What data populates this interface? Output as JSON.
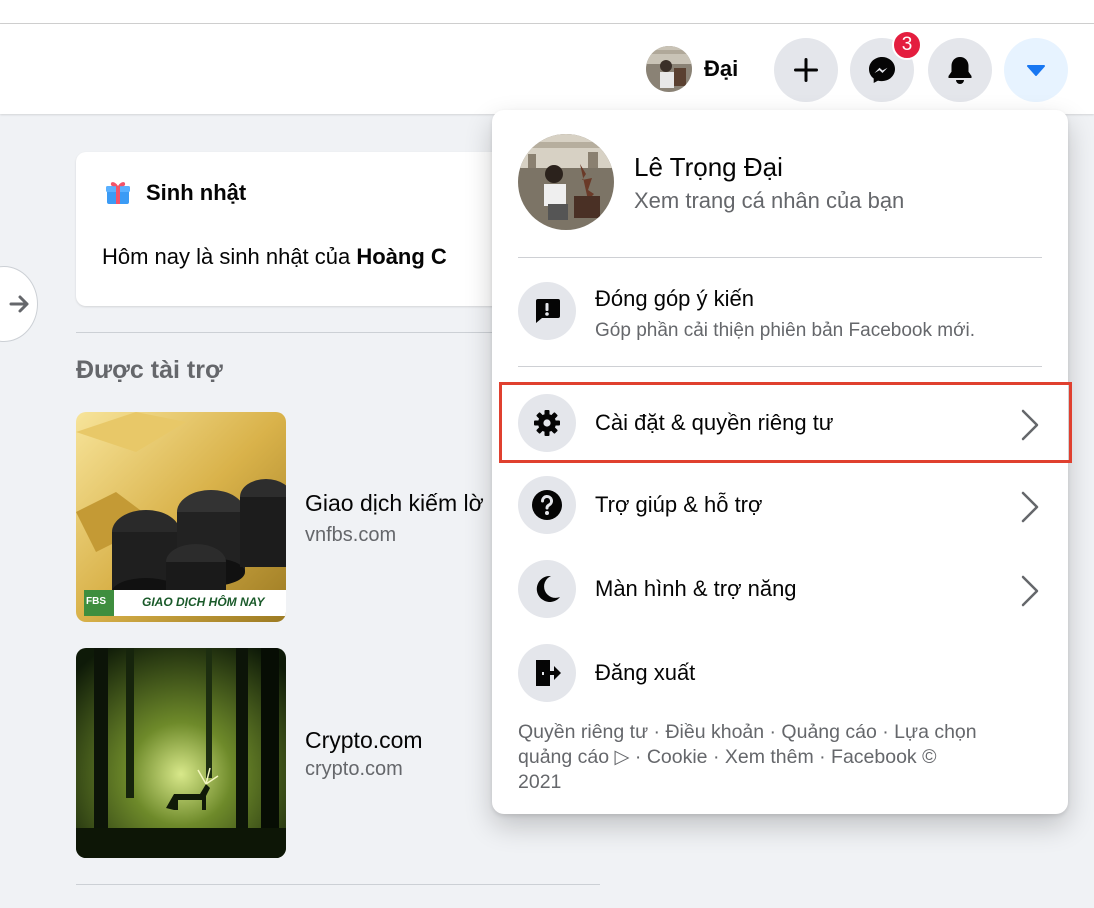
{
  "header": {
    "profile_name": "Đại",
    "messenger_badge": "3"
  },
  "birthday": {
    "title": "Sinh nhật",
    "text_prefix": "Hôm nay là sinh nhật của ",
    "text_bold": "Hoàng C"
  },
  "sponsored": {
    "title": "Được tài trợ",
    "ads": [
      {
        "title": "Giao dịch kiếm lờ",
        "domain": "vnfbs.com",
        "banner_text": "GIAO DỊCH HÔM NAY",
        "logo": "FBS"
      },
      {
        "title": "Crypto.com",
        "domain": "crypto.com"
      }
    ]
  },
  "menu": {
    "profile_name": "Lê Trọng Đại",
    "profile_sub": "Xem trang cá nhân của bạn",
    "feedback": {
      "label": "Đóng góp ý kiến",
      "desc": "Góp phần cải thiện phiên bản Facebook mới."
    },
    "items": [
      {
        "label": "Cài đặt & quyền riêng tư",
        "icon": "gear-icon"
      },
      {
        "label": "Trợ giúp & hỗ trợ",
        "icon": "question-icon"
      },
      {
        "label": "Màn hình & trợ năng",
        "icon": "moon-icon"
      },
      {
        "label": "Đăng xuất",
        "icon": "logout-icon"
      }
    ],
    "footer_line1": "Quyền riêng tư · Điều khoản · Quảng cáo · Lựa chọn",
    "footer_line2": "quảng cáo ▷ · Cookie · Xem thêm · Facebook ©",
    "footer_line3": "2021"
  },
  "colors": {
    "accent": "#1877f2",
    "badge": "#e41e3f",
    "highlight": "#e0402f"
  }
}
